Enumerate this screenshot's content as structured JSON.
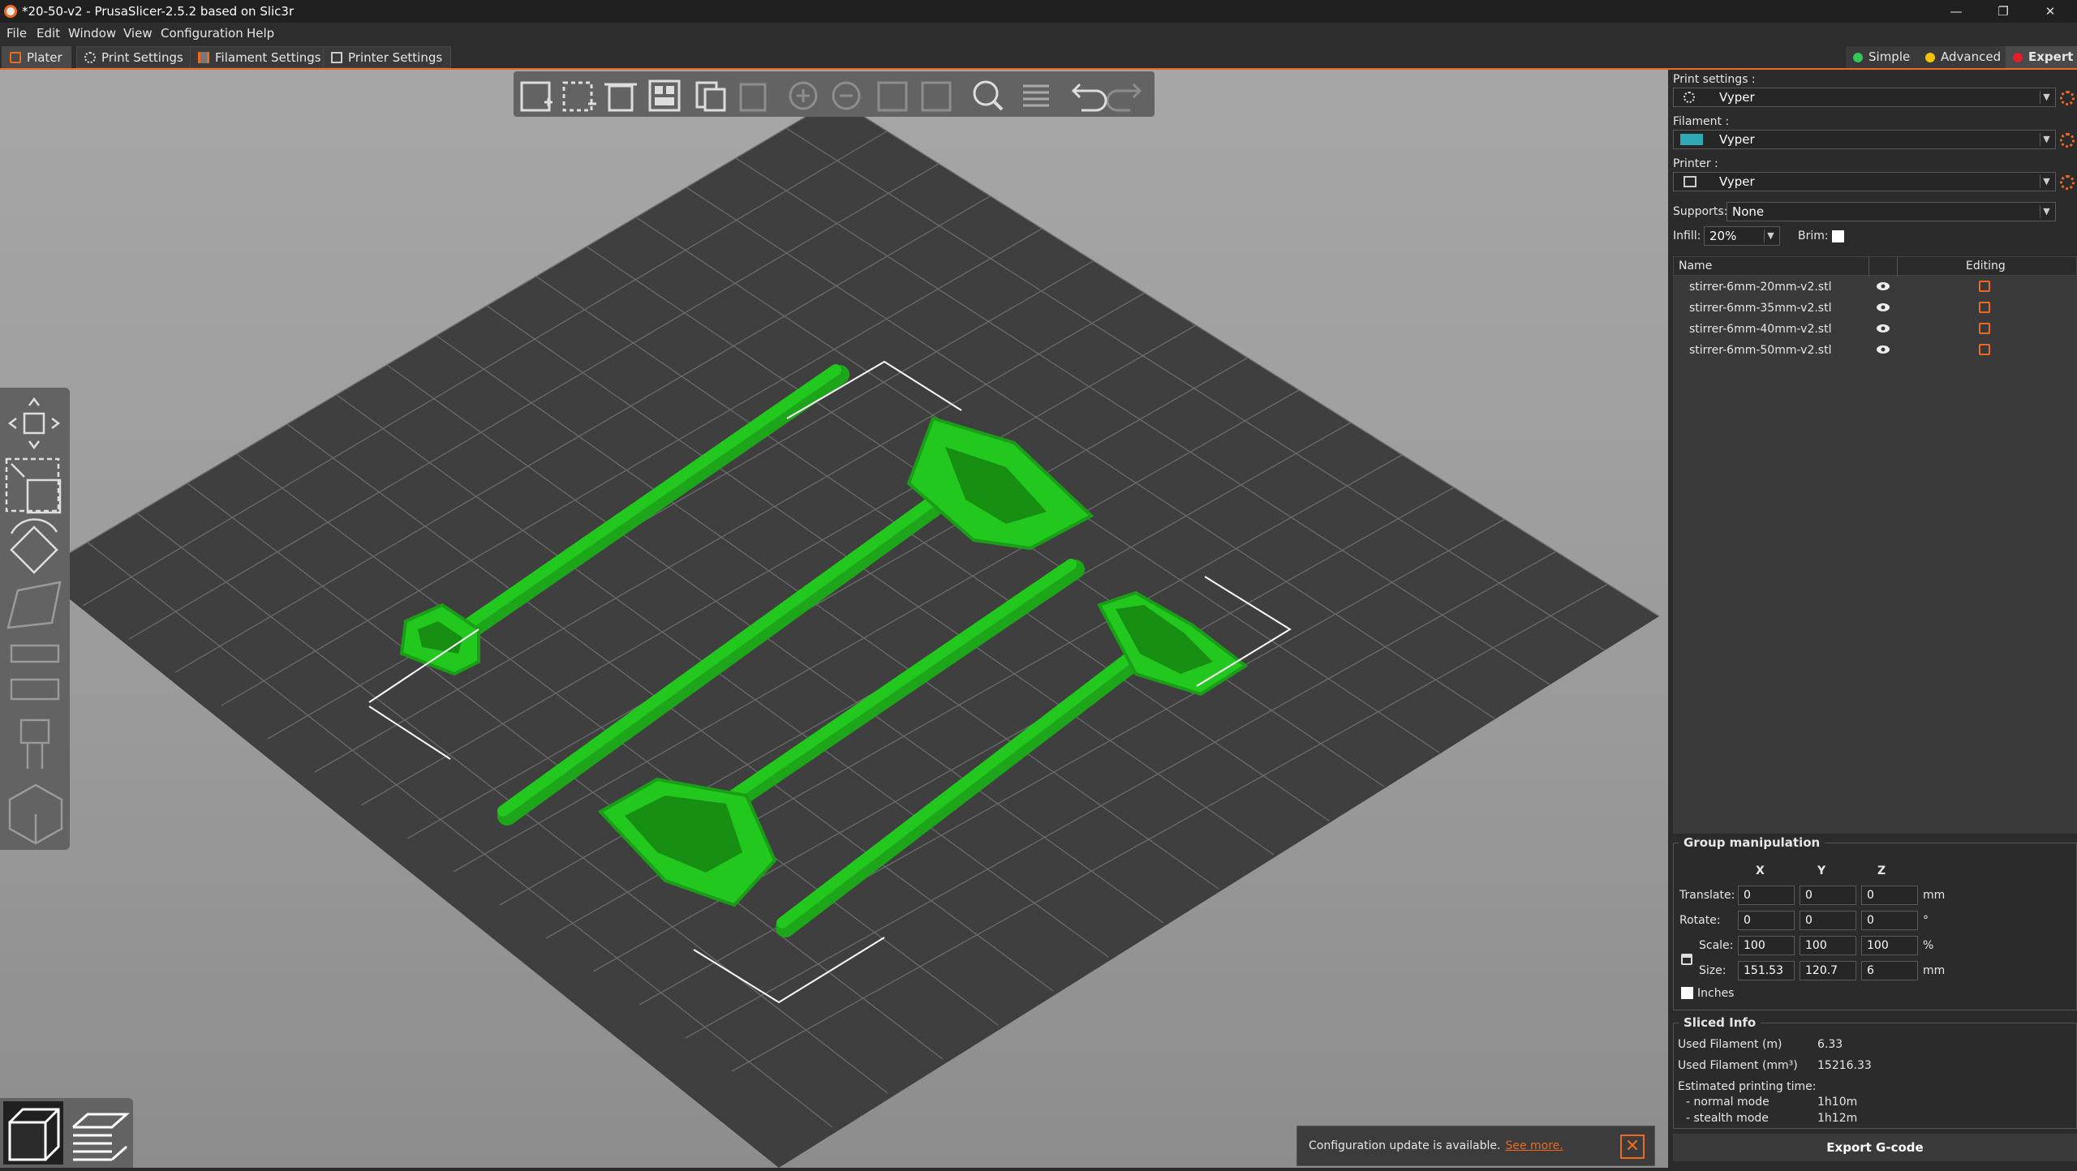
{
  "window": {
    "title": "*20-50-v2 - PrusaSlicer-2.5.2 based on Slic3r",
    "minimize": "—",
    "restore": "❐",
    "close": "✕"
  },
  "menu": [
    "File",
    "Edit",
    "Window",
    "View",
    "Configuration",
    "Help"
  ],
  "tabs": [
    {
      "label": "Plater",
      "icon": "plater-icon"
    },
    {
      "label": "Print Settings",
      "icon": "gear-icon"
    },
    {
      "label": "Filament Settings",
      "icon": "spool-icon"
    },
    {
      "label": "Printer Settings",
      "icon": "printer-icon"
    }
  ],
  "modes": [
    {
      "label": "Simple",
      "color": "#34c759"
    },
    {
      "label": "Advanced",
      "color": "#f5c400"
    },
    {
      "label": "Expert",
      "color": "#e0202a"
    }
  ],
  "toolbar_icons": [
    "add-icon",
    "delete-icon",
    "delete-all-icon",
    "arrange-icon",
    "copy-icon",
    "paste-icon",
    "add-instance-icon",
    "remove-instance-icon",
    "split-objects-icon",
    "split-parts-icon",
    "search-icon",
    "layers-editing-icon",
    "undo-icon",
    "redo-icon"
  ],
  "gizmo_icons": [
    "move-icon",
    "scale-icon",
    "rotate-icon",
    "place-on-face-icon",
    "cut-icon",
    "hollow-icon",
    "supports-paint-icon",
    "seam-paint-icon",
    "measure-icon"
  ],
  "view_icons": [
    "3d-view-icon",
    "preview-layers-icon"
  ],
  "sidebar": {
    "print_settings_label": "Print settings :",
    "print_settings_value": "Vyper",
    "filament_label": "Filament :",
    "filament_value": "Vyper",
    "filament_color": "#2fa9b4",
    "printer_label": "Printer :",
    "printer_value": "Vyper",
    "supports_label": "Supports:",
    "supports_value": "None",
    "infill_label": "Infill:",
    "infill_value": "20%",
    "brim_label": "Brim:",
    "list_header_name": "Name",
    "list_header_editing": "Editing",
    "objects": [
      {
        "name": "stirrer-6mm-20mm-v2.stl"
      },
      {
        "name": "stirrer-6mm-35mm-v2.stl"
      },
      {
        "name": "stirrer-6mm-40mm-v2.stl"
      },
      {
        "name": "stirrer-6mm-50mm-v2.stl"
      }
    ]
  },
  "group": {
    "title": "Group manipulation",
    "x": "X",
    "y": "Y",
    "z": "Z",
    "translate_label": "Translate:",
    "translate": [
      "0",
      "0",
      "0"
    ],
    "translate_unit": "mm",
    "rotate_label": "Rotate:",
    "rotate": [
      "0",
      "0",
      "0"
    ],
    "rotate_unit": "°",
    "scale_label": "Scale:",
    "scale": [
      "100",
      "100",
      "100"
    ],
    "scale_unit": "%",
    "size_label": "Size:",
    "size": [
      "151.53",
      "120.7",
      "6"
    ],
    "size_unit": "mm",
    "inches_label": "Inches"
  },
  "sliced": {
    "title": "Sliced Info",
    "used_m_label": "Used Filament (m)",
    "used_m": "6.33",
    "used_mm3_label": "Used Filament (mm³)",
    "used_mm3": "15216.33",
    "time_label": "Estimated printing time:",
    "normal_label": "- normal mode",
    "normal": "1h10m",
    "stealth_label": "- stealth mode",
    "stealth": "1h12m"
  },
  "export_label": "Export G-code",
  "notification": {
    "text": "Configuration update is available.",
    "link": "See more."
  },
  "colors": {
    "accent": "#ed6b21",
    "object": "#22c81e",
    "bed": "#3f3f3f"
  }
}
